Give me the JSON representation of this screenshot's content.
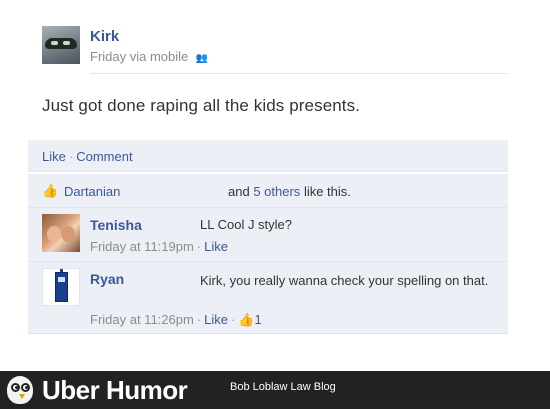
{
  "post": {
    "author": "Kirk",
    "meta": "Friday via mobile",
    "status": "Just got done raping all the kids presents."
  },
  "actions": {
    "like": "Like",
    "separator": "·",
    "comment": "Comment"
  },
  "likes": {
    "liker": "Dartanian",
    "and": "and",
    "others_link": "5 others",
    "suffix": "like this."
  },
  "comments": [
    {
      "name": "Tenisha",
      "text": "LL Cool J style?",
      "time": "Friday at 11:19pm",
      "like": "Like"
    },
    {
      "name": "Ryan",
      "text": "Kirk, you really wanna check your spelling on that.",
      "time": "Friday at 11:26pm",
      "like": "Like",
      "like_count": "1"
    }
  ],
  "footer": {
    "brand": "Uber Humor",
    "tagline": "Bob Loblaw Law Blog"
  },
  "colors": {
    "link": "#3b5998",
    "panel": "#eceff5",
    "footer": "#222222"
  }
}
